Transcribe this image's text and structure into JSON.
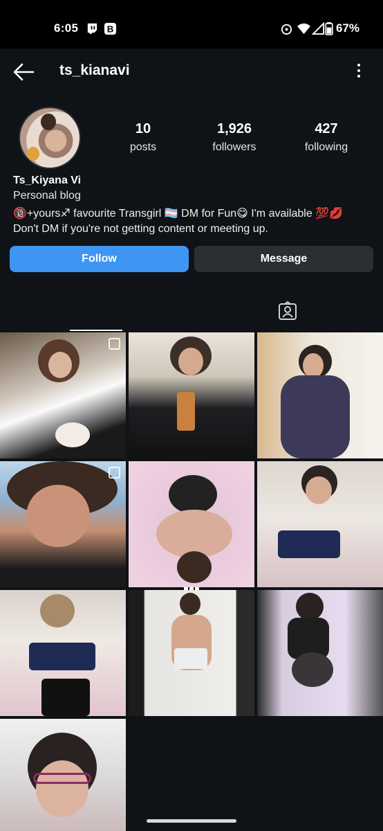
{
  "status_bar": {
    "time": "6:05",
    "battery": "67%",
    "left_icons": [
      "twitch-icon",
      "b-app-icon"
    ],
    "right_icons": [
      "alarm-icon",
      "wifi-icon",
      "signal-icon",
      "battery-icon"
    ]
  },
  "header": {
    "username": "ts_kianavi"
  },
  "profile": {
    "stats": [
      {
        "value": "10",
        "label": "posts"
      },
      {
        "value": "1,926",
        "label": "followers"
      },
      {
        "value": "427",
        "label": "following"
      }
    ],
    "display_name": "Ts_Kiyana Vi",
    "category": "Personal blog",
    "bio_line1": "🔞+yours♐ favourite Transgirl 🏳️‍⚧️ DM for Fun😋 I'm available 💯💋",
    "bio_line2": "Don't DM if you're not getting content or meeting up."
  },
  "actions": {
    "follow_label": "Follow",
    "message_label": "Message"
  },
  "tabs": [
    {
      "name": "grid",
      "icon": "grid-icon",
      "active": true
    },
    {
      "name": "tagged",
      "icon": "tagged-person-icon",
      "active": false
    }
  ],
  "colors": {
    "follow_blue": "#3f95f2",
    "message_gray": "#2b2e33",
    "background": "#0f1216"
  },
  "posts": [
    {
      "multi": true
    },
    {
      "multi": false
    },
    {
      "multi": false
    },
    {
      "multi": true
    },
    {
      "multi": false
    },
    {
      "multi": false
    },
    {
      "multi": false
    },
    {
      "multi": false
    },
    {
      "multi": false
    },
    {
      "multi": false
    }
  ]
}
